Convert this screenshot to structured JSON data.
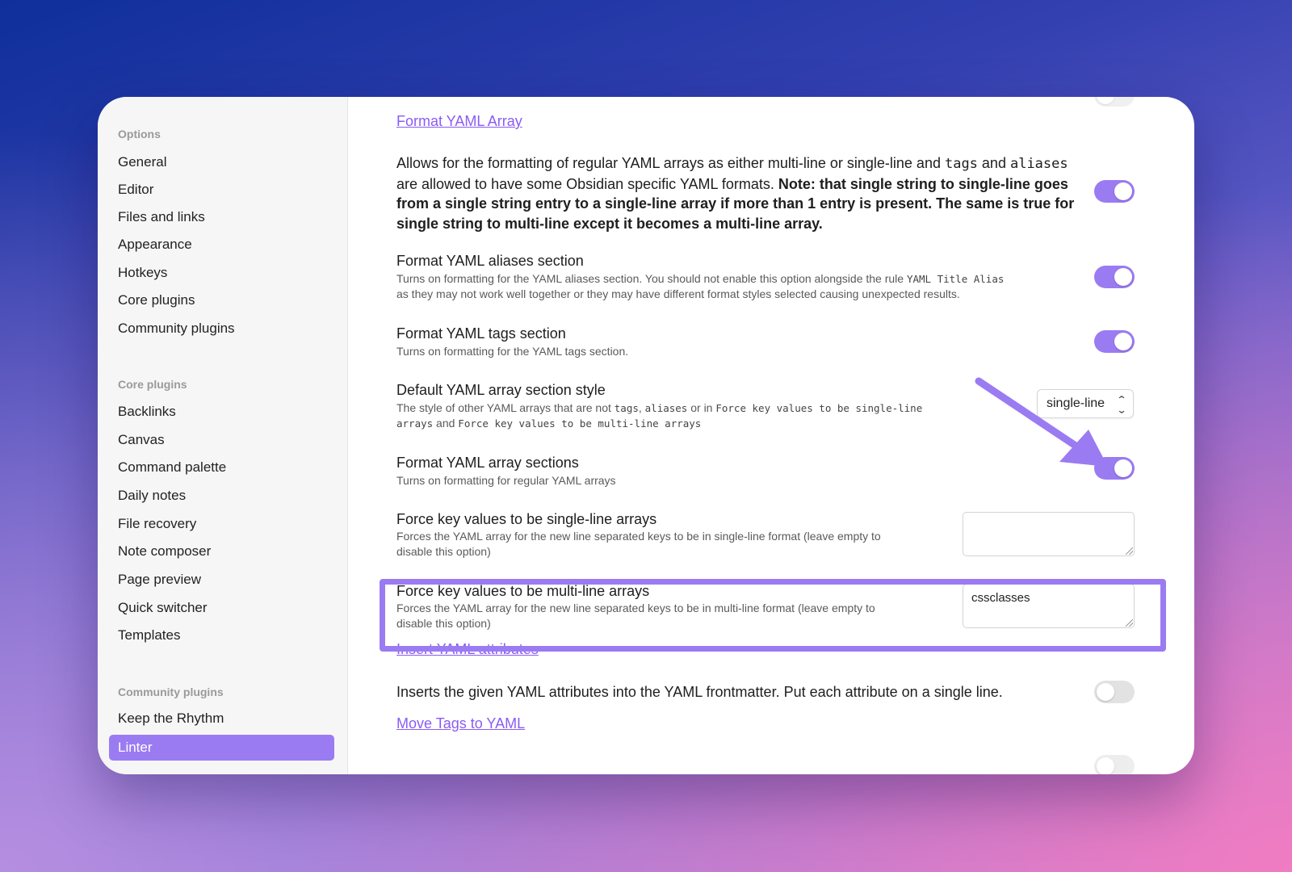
{
  "sidebar": {
    "options_title": "Options",
    "options": [
      "General",
      "Editor",
      "Files and links",
      "Appearance",
      "Hotkeys",
      "Core plugins",
      "Community plugins"
    ],
    "core_title": "Core plugins",
    "core": [
      "Backlinks",
      "Canvas",
      "Command palette",
      "Daily notes",
      "File recovery",
      "Note composer",
      "Page preview",
      "Quick switcher",
      "Templates"
    ],
    "community_title": "Community plugins",
    "community": [
      "Keep the Rhythm",
      "Linter"
    ],
    "active_item": "Linter"
  },
  "content": {
    "format_yaml_array_link": "Format YAML Array",
    "format_yaml_array_desc": {
      "part1": "Allows for the formatting of regular YAML arrays as either multi-line or single-line and ",
      "code1": "tags",
      "part2": " and ",
      "code2": "aliases",
      "part3": " are allowed to have some Obsidian specific YAML formats. ",
      "bold": "Note: that single string to single-line goes from a single string entry to a single-line array if more than 1 entry is present. The same is true for single string to multi-line except it becomes a multi-line array."
    },
    "aliases_section": {
      "name": "Format YAML aliases section",
      "desc1": "Turns on formatting for the YAML aliases section. You should not enable this option alongside the rule ",
      "code": "YAML Title Alias",
      "desc2": "as they may not work well together or they may have different format styles selected causing unexpected results."
    },
    "tags_section": {
      "name": "Format YAML tags section",
      "desc": "Turns on formatting for the YAML tags section."
    },
    "default_style": {
      "name": "Default YAML array section style",
      "desc1": "The style of other YAML arrays that are not ",
      "code1": "tags",
      "sep1": ", ",
      "code2": "aliases",
      "sep2": " or in ",
      "code3": "Force key values to be single-line",
      "code3b": "arrays",
      "sep3": " and ",
      "code4": "Force key values to be multi-line arrays",
      "dropdown_value": "single-line"
    },
    "array_sections": {
      "name": "Format YAML array sections",
      "desc": "Turns on formatting for regular YAML arrays"
    },
    "force_single": {
      "name": "Force key values to be single-line arrays",
      "desc1": "Forces the YAML array for the new line separated keys to be in single-line format (leave empty to",
      "desc2": "disable this option)",
      "value": ""
    },
    "force_multi": {
      "name": "Force key values to be multi-line arrays",
      "desc1": "Forces the YAML array for the new line separated keys to be in multi-line format (leave empty to",
      "desc2": "disable this option)",
      "value": "cssclasses"
    },
    "insert_attrs_link": "Insert YAML attributes",
    "insert_attrs_desc": "Inserts the given YAML attributes into the YAML frontmatter. Put each attribute on a single line.",
    "move_tags_link": "Move Tags to YAML"
  },
  "colors": {
    "accent": "#9b7bf2",
    "link": "#8a5cf5"
  }
}
